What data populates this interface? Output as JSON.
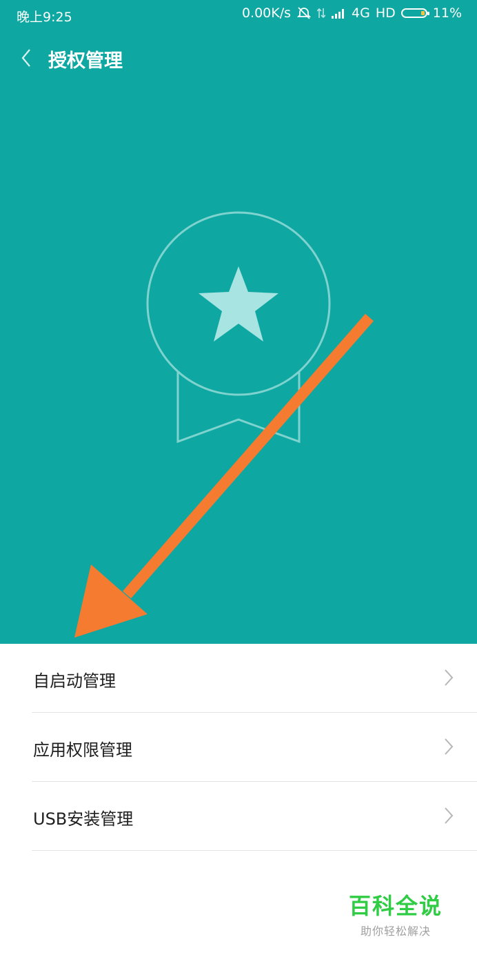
{
  "status_bar": {
    "time": "晚上9:25",
    "speed": "0.00K/s",
    "network": "4G",
    "hd": "HD",
    "battery": "11%"
  },
  "header": {
    "title": "授权管理"
  },
  "menu": {
    "items": [
      {
        "label": "自启动管理"
      },
      {
        "label": "应用权限管理"
      },
      {
        "label": "USB安装管理"
      }
    ]
  },
  "watermark": {
    "title": "百科全说",
    "subtitle": "助你轻松解决"
  },
  "colors": {
    "hero_background": "#0ea7a2",
    "badge_outline": "#7fd3cf",
    "star_fill": "#a8e4e1",
    "annotation_arrow": "#f57b30",
    "watermark_green": "#2fcc44"
  },
  "icons": {
    "back": "chevron-left-icon",
    "badge": "award-badge-icon",
    "star": "star-icon",
    "row_chevron": "chevron-right-icon"
  }
}
